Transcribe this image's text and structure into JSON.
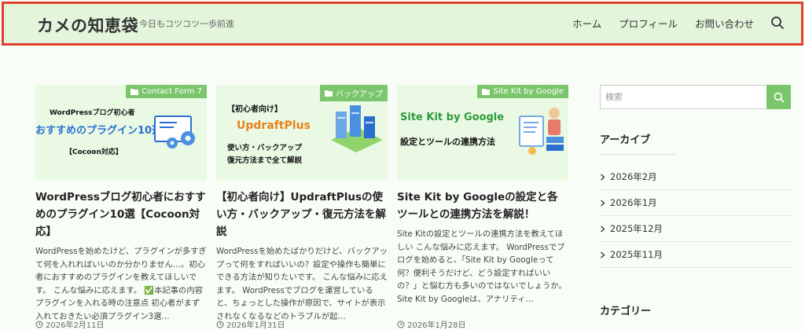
{
  "header": {
    "site_title": "カメの知恵袋",
    "tagline": "今日もコツコツ一歩前進",
    "nav": [
      "ホーム",
      "プロフィール",
      "お問い合わせ"
    ]
  },
  "cards": [
    {
      "category": "Contact Form 7",
      "thumb_lines": [
        "WordPressブログ初心者",
        "おすすめのプラグイン10選",
        "【Cocoon対応】"
      ],
      "title": "WordPressブログ初心者におすすめのプラグイン10選【Cocoon対応】",
      "excerpt": "WordPressを始めたけど、プラグインが多すぎて何を入れればいいのか分かりません…。初心者におすすめのプラグインを教えてほしいです。 こんな悩みに応えます。 ✅本記事の内容 プラグインを入れる時の注意点 初心者がまず入れておきたい必須プラグイン3選…",
      "date": "2026年2月11日"
    },
    {
      "category": "バックアップ",
      "thumb_lines": [
        "【初心者向け】",
        "UpdraftPlus",
        "使い方・バックアップ",
        "復元方法まで全て解説"
      ],
      "title": "【初心者向け】UpdraftPlusの使い方・バックアップ・復元方法を解説",
      "excerpt": "WordPressを始めたばかりだけど、バックアップって何をすればいいの？設定や操作も簡単にできる方法が知りたいです。 こんな悩みに応えます。 WordPressでブログを運営していると、ちょっとした操作が原因で、サイトが表示されなくなるなどのトラブルが起…",
      "date": "2026年1月31日"
    },
    {
      "category": "Site Kit by Google",
      "thumb_lines": [
        "Site Kit by Google",
        "設定とツールの連携方法"
      ],
      "title": "Site Kit by Googleの設定と各ツールとの連携方法を解説！",
      "excerpt": "Site Kitの設定とツールの連携方法を教えてほしい こんな悩みに応えます。 WordPressでブログを始めると、「Site Kit by Googleって何？便利そうだけど、どう設定すればいいの？」と悩む方も多いのではないでしょうか。 Site Kit by Googleは、アナリティ…",
      "date": "2026年1月28日"
    }
  ],
  "sidebar": {
    "search_placeholder": "検索",
    "archive_title": "アーカイブ",
    "archives": [
      "2026年2月",
      "2026年1月",
      "2025年12月",
      "2025年11月"
    ],
    "category_title": "カテゴリー"
  },
  "colors": {
    "accent": "#7bc66c",
    "header_bg": "#e3f5db",
    "highlight_border": "#e2402c"
  }
}
